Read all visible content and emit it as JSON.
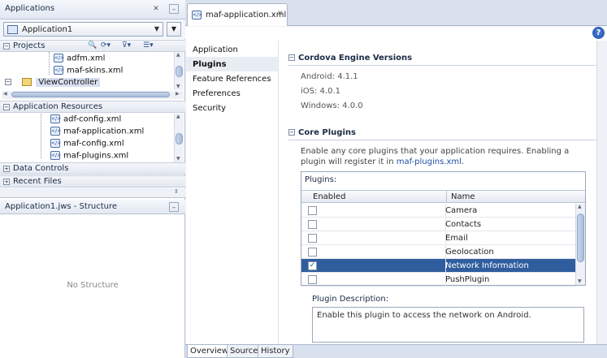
{
  "applications_panel": {
    "title": "Applications",
    "app_selector": "Application1",
    "projects_header": "Projects",
    "project_items": [
      "adfm.xml",
      "maf-skins.xml"
    ],
    "view_controller": "ViewController",
    "app_resources_header": "Application Resources",
    "resource_items": [
      "adf-config.xml",
      "maf-application.xml",
      "maf-config.xml",
      "maf-plugins.xml"
    ],
    "data_controls_header": "Data Controls",
    "recent_files_header": "Recent Files"
  },
  "structure_panel": {
    "title": "Application1.jws - Structure",
    "empty_text": "No Structure"
  },
  "editor": {
    "tab_title": "maf-application.xml",
    "help_label": "?",
    "nav_items": [
      "Application",
      "Plugins",
      "Feature References",
      "Preferences",
      "Security"
    ],
    "selected_nav": "Plugins",
    "cordova_section": {
      "title": "Cordova Engine Versions",
      "versions": [
        "Android: 4.1.1",
        "iOS: 4.0.1",
        "Windows: 4.0.0"
      ]
    },
    "core_plugins_section": {
      "title": "Core Plugins",
      "description_prefix": "Enable any core plugins that your application requires. Enabling a plugin will register it in",
      "description_link": "maf-plugins.xml",
      "description_suffix": ".",
      "plugins_caption": "Plugins:",
      "col_enabled": "Enabled",
      "col_name": "Name",
      "rows": [
        {
          "name": "Camera",
          "enabled": false,
          "selected": false
        },
        {
          "name": "Contacts",
          "enabled": false,
          "selected": false
        },
        {
          "name": "Email",
          "enabled": false,
          "selected": false
        },
        {
          "name": "Geolocation",
          "enabled": false,
          "selected": false
        },
        {
          "name": "Network Information",
          "enabled": true,
          "selected": true
        },
        {
          "name": "PushPlugin",
          "enabled": false,
          "selected": false
        }
      ],
      "plugin_description_label": "Plugin Description:",
      "plugin_description": "Enable this plugin to access the network on Android."
    },
    "bottom_tabs": [
      "Overview",
      "Source",
      "History"
    ],
    "active_bottom_tab": "Overview"
  }
}
